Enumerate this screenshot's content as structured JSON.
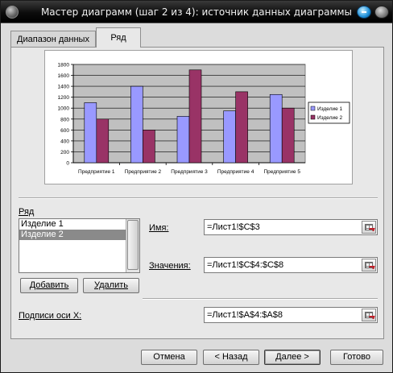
{
  "window": {
    "title": "Мастер диаграмм (шаг 2 из 4): источник данных диаграммы"
  },
  "tabs": [
    {
      "label": "Диапазон данных",
      "active": false
    },
    {
      "label": "Ряд",
      "active": true
    }
  ],
  "chart_data": {
    "type": "bar",
    "categories": [
      "Предприятие 1",
      "Предприятие 2",
      "Предприятие 3",
      "Предприятие 4",
      "Предприятие 5"
    ],
    "series": [
      {
        "name": "Изделие 1",
        "color": "#9999ff",
        "values": [
          1100,
          1400,
          850,
          950,
          1250
        ]
      },
      {
        "name": "Изделие 2",
        "color": "#993366",
        "values": [
          800,
          600,
          1700,
          1300,
          1000
        ]
      }
    ],
    "ylim": [
      0,
      1800
    ],
    "yticks": [
      0,
      200,
      400,
      600,
      800,
      1000,
      1200,
      1400,
      1600,
      1800
    ],
    "grid": true,
    "plot_background": "#c0c0c0",
    "legend_position": "right"
  },
  "series_section": {
    "label": "Ряд",
    "items": [
      "Изделие 1",
      "Изделие 2"
    ],
    "selected": "Изделие 2",
    "add_button": "Добавить",
    "remove_button": "Удалить"
  },
  "name_field": {
    "label": "Имя:",
    "value": "=Лист1!$C$3"
  },
  "values_field": {
    "label": "Значения:",
    "value": "=Лист1!$C$4:$C$8"
  },
  "x_labels_field": {
    "label": "Подписи оси X:",
    "value": "=Лист1!$A$4:$A$8"
  },
  "footer": {
    "cancel": "Отмена",
    "back": "< Назад",
    "next": "Далее >",
    "finish": "Готово"
  }
}
